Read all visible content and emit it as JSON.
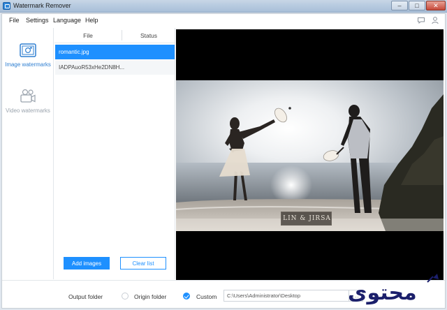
{
  "window": {
    "title": "Watermark Remover",
    "minimize_label": "–",
    "maximize_label": "□",
    "close_label": "✕"
  },
  "menu": {
    "file": "File",
    "settings": "Settings",
    "language": "Language",
    "help": "Help"
  },
  "top_icons": [
    "chat-icon",
    "user-icon"
  ],
  "sidebar": {
    "items": [
      {
        "label": "Image watermarks",
        "icon": "image-icon",
        "active": true
      },
      {
        "label": "Video watermarks",
        "icon": "video-camera-icon",
        "active": false
      }
    ]
  },
  "file_list": {
    "columns": [
      "File",
      "Status"
    ],
    "rows": [
      {
        "file": "romantic.jpg",
        "status": "",
        "selected": true
      },
      {
        "file": "IADPAuoR53xHe2DN8H...",
        "status": "",
        "selected": false
      }
    ]
  },
  "buttons": {
    "add_images": "Add images",
    "clear_list": "Clear list"
  },
  "preview": {
    "watermark_text": "LIN & JIRSA"
  },
  "output": {
    "label": "Output folder",
    "origin_label": "Origin folder",
    "custom_label": "Custom",
    "selected": "Custom",
    "path": "C:\\Users\\Administrator\\Desktop",
    "browse_label": "…"
  },
  "logo_text": "محتوى",
  "colors": {
    "accent": "#1e90ff",
    "selected_row": "#1e90ff",
    "preview_bg": "#000000"
  }
}
